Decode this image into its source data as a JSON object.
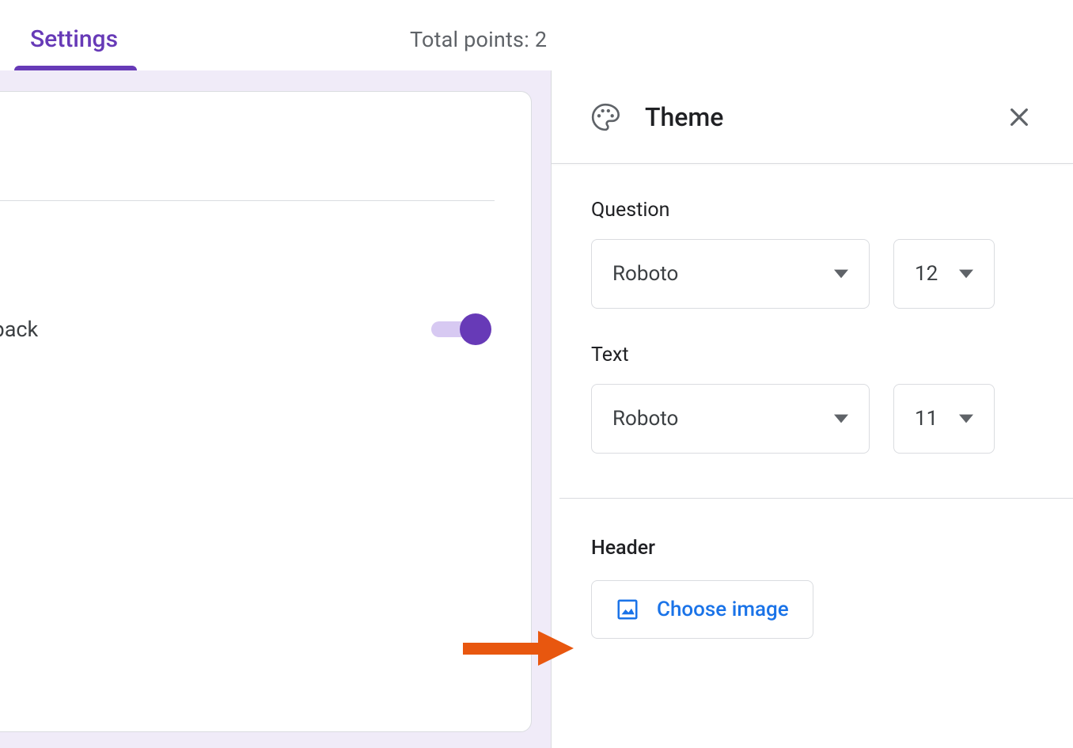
{
  "topbar": {
    "tab_settings": "Settings",
    "total_points": "Total points: 2"
  },
  "settings_card": {
    "feedback_label": "edback"
  },
  "theme_panel": {
    "title": "Theme",
    "question": {
      "label": "Question",
      "font": "Roboto",
      "size": "12"
    },
    "text": {
      "label": "Text",
      "font": "Roboto",
      "size": "11"
    },
    "header": {
      "label": "Header",
      "choose_image": "Choose image"
    }
  }
}
